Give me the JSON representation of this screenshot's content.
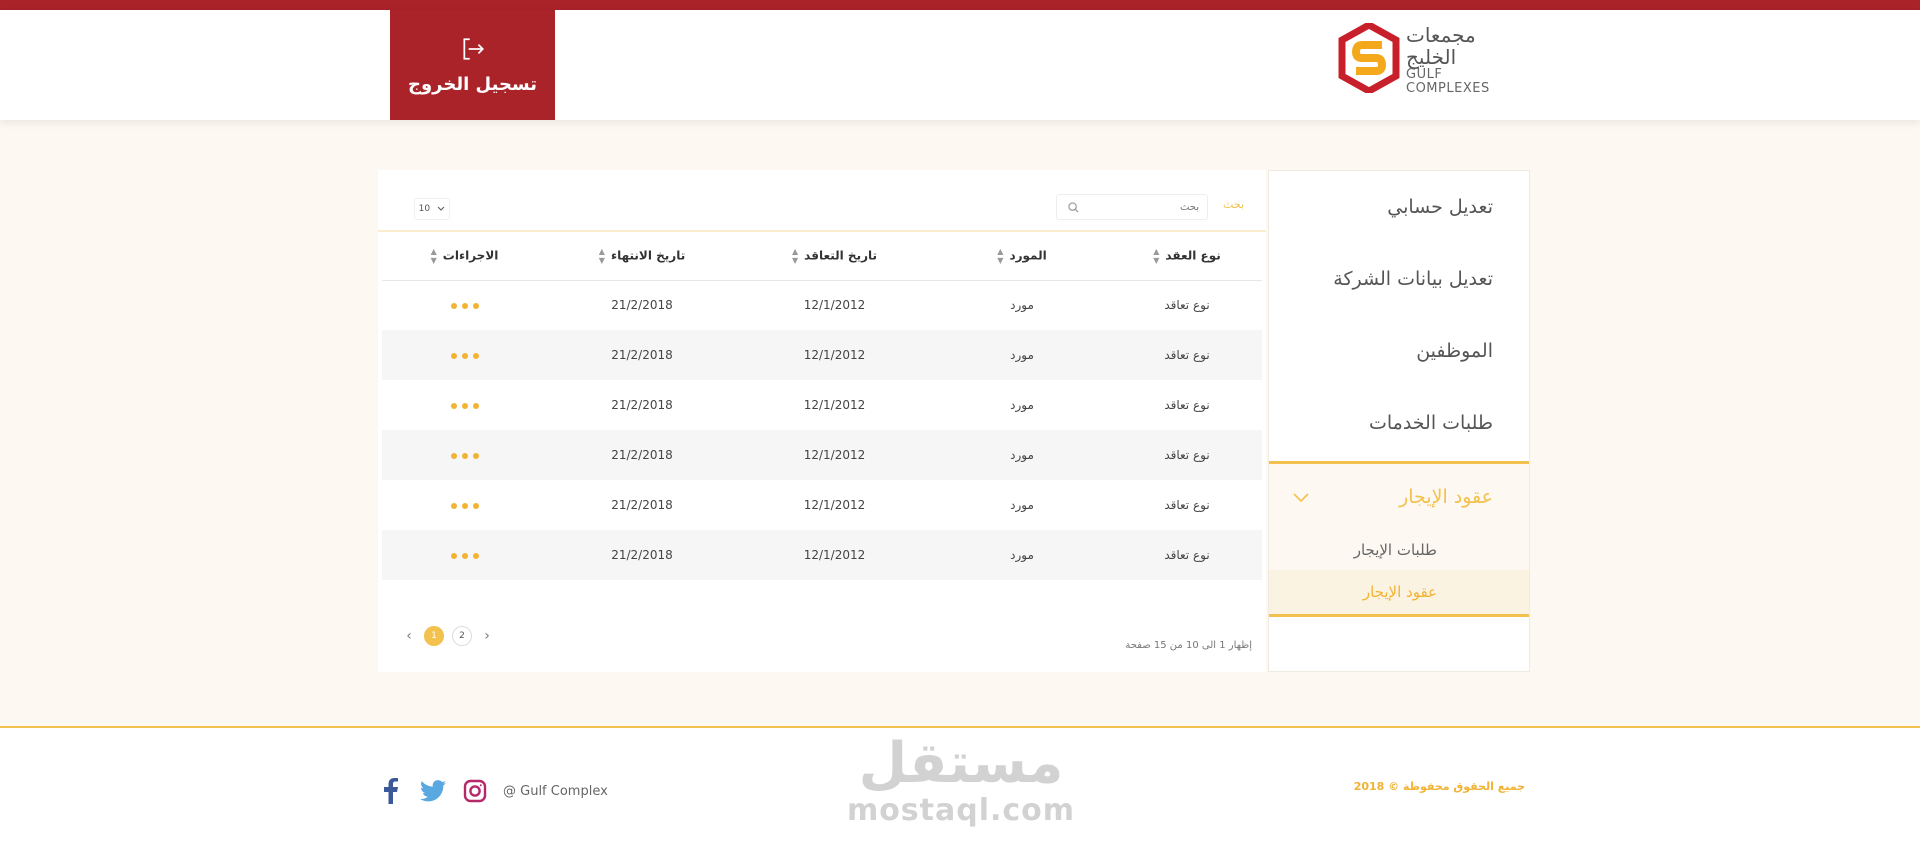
{
  "header": {
    "logout_label": "تسجيل الخروج",
    "logo_ar": "مجمعات الخليج",
    "logo_en": "GULF COMPLEXES"
  },
  "sidebar": {
    "items": [
      {
        "label": "تعديل حسابي"
      },
      {
        "label": "تعديل بيانات الشركة"
      },
      {
        "label": "الموظفين"
      },
      {
        "label": "طلبات الخدمات"
      }
    ],
    "group": {
      "label": "عقود الإيجار",
      "children": [
        {
          "label": "طلبات الإيجار"
        },
        {
          "label": "عقود الإيجار"
        }
      ]
    }
  },
  "toolbar": {
    "search_label": "بحث",
    "search_placeholder": "بحث",
    "page_length": "10"
  },
  "table": {
    "headers": [
      "نوع العقد",
      "المورد",
      "تاريخ التعاقد",
      "تاريخ الانتهاء",
      "الاجراءات"
    ],
    "rows": [
      [
        "نوع تعاقد",
        "مورد",
        "12/1/2012",
        "21/2/2018"
      ],
      [
        "نوع تعاقد",
        "مورد",
        "12/1/2012",
        "21/2/2018"
      ],
      [
        "نوع تعاقد",
        "مورد",
        "12/1/2012",
        "21/2/2018"
      ],
      [
        "نوع تعاقد",
        "مورد",
        "12/1/2012",
        "21/2/2018"
      ],
      [
        "نوع تعاقد",
        "مورد",
        "12/1/2012",
        "21/2/2018"
      ],
      [
        "نوع تعاقد",
        "مورد",
        "12/1/2012",
        "21/2/2018"
      ]
    ]
  },
  "pagination": {
    "info": "إظهار 1 الى 10 من 15 صفحة",
    "pages": [
      "1",
      "2"
    ],
    "current": "1"
  },
  "footer": {
    "copyright": "جميع الحقوق محفوظة © 2018",
    "brand": "@ Gulf Complex",
    "watermark_ar": "مستقل",
    "watermark_en": "mostaql.com"
  },
  "colors": {
    "brand_red": "#a92329",
    "accent_yellow": "#f2c14e",
    "facebook": "#3b5998",
    "twitter": "#5aa8e0",
    "instagram": "#b5296a"
  }
}
